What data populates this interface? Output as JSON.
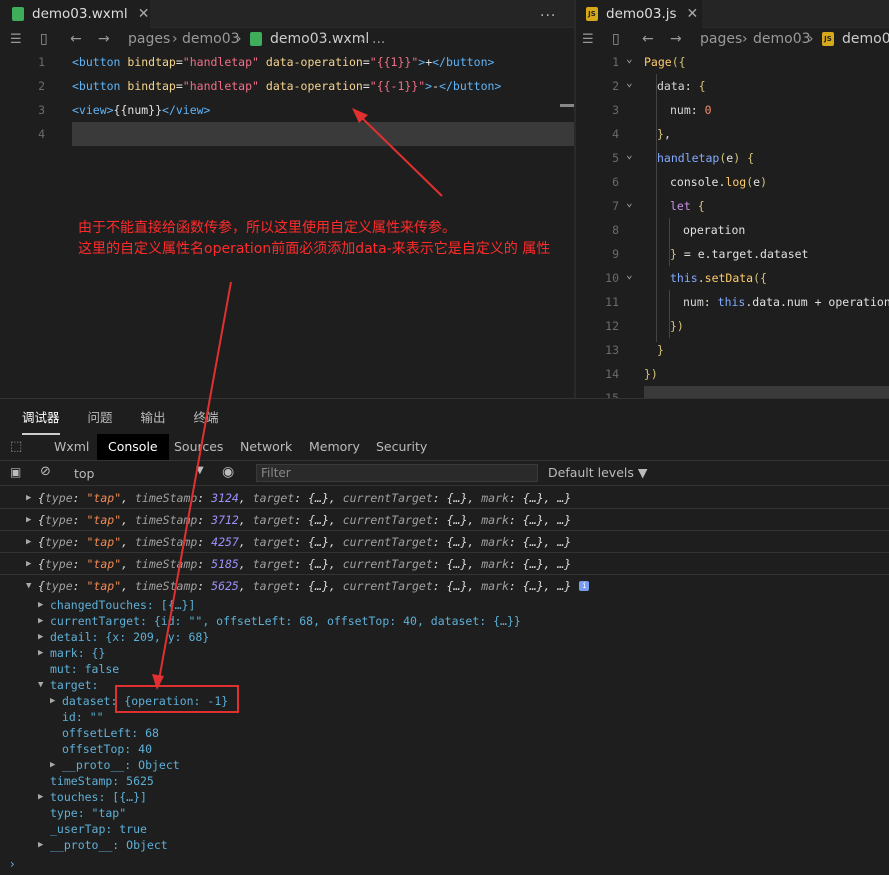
{
  "left_editor": {
    "tab": {
      "name": "demo03.wxml",
      "close": "✕"
    },
    "more": "...",
    "breadcrumb": {
      "part1": "pages",
      "part2": "demo03",
      "part3": "demo03.wxml",
      "ellipsis": "..."
    },
    "lines": [
      {
        "num": "1",
        "segs": [
          [
            "t-tag",
            "<button "
          ],
          [
            "t-attr",
            "bindtap"
          ],
          [
            "t-plain",
            "="
          ],
          [
            "t-str",
            "\"handletap\""
          ],
          [
            "t-plain",
            " "
          ],
          [
            "t-attr",
            "data-operation"
          ],
          [
            "t-plain",
            "="
          ],
          [
            "t-str",
            "\"{{1}}\""
          ],
          [
            "t-tag",
            ">"
          ],
          [
            "t-plain",
            "+"
          ],
          [
            "t-tag",
            "</button>"
          ]
        ]
      },
      {
        "num": "2",
        "segs": [
          [
            "t-tag",
            "<button "
          ],
          [
            "t-attr",
            "bindtap"
          ],
          [
            "t-plain",
            "="
          ],
          [
            "t-str",
            "\"handletap\""
          ],
          [
            "t-plain",
            " "
          ],
          [
            "t-attr",
            "data-operation"
          ],
          [
            "t-plain",
            "="
          ],
          [
            "t-str",
            "\"{{-1}}\""
          ],
          [
            "t-tag",
            ">"
          ],
          [
            "t-plain",
            "-"
          ],
          [
            "t-tag",
            "</button>"
          ]
        ]
      },
      {
        "num": "3",
        "segs": [
          [
            "t-tag",
            "<view>"
          ],
          [
            "t-plain",
            "{{num}}"
          ],
          [
            "t-tag",
            "</view>"
          ]
        ]
      },
      {
        "num": "4",
        "segs": []
      }
    ],
    "annotation": [
      "由于不能直接给函数传参，所以这里使用自定义属性来传参。",
      "这里的自定义属性名operation前面必须添加data-来表示它是自定义的 属性"
    ]
  },
  "right_editor": {
    "tab": {
      "name": "demo03.js",
      "close": "✕"
    },
    "breadcrumb": {
      "part1": "pages",
      "part2": "demo03",
      "part3": "demo0"
    },
    "lines": [
      {
        "num": "1",
        "segs": [
          [
            "t-fn",
            "Page"
          ],
          [
            "t-pun",
            "({"
          ]
        ]
      },
      {
        "num": "2",
        "segs": [
          [
            "t-prop",
            "data"
          ],
          [
            "t-plain",
            ": "
          ],
          [
            "t-pun",
            "{"
          ]
        ]
      },
      {
        "num": "3",
        "segs": [
          [
            "t-prop",
            "num"
          ],
          [
            "t-plain",
            ": "
          ],
          [
            "t-num",
            "0"
          ]
        ]
      },
      {
        "num": "4",
        "segs": [
          [
            "t-pun",
            "}"
          ],
          [
            "t-plain",
            ","
          ]
        ]
      },
      {
        "num": "5",
        "segs": [
          [
            "t-blue",
            "handletap"
          ],
          [
            "t-pun",
            "("
          ],
          [
            "t-plain",
            "e"
          ],
          [
            "t-pun",
            ")"
          ],
          [
            "t-plain",
            " "
          ],
          [
            "t-pun",
            "{"
          ]
        ]
      },
      {
        "num": "6",
        "segs": [
          [
            "t-plain",
            "console"
          ],
          [
            "t-plain",
            "."
          ],
          [
            "t-fn",
            "log"
          ],
          [
            "t-pun",
            "("
          ],
          [
            "t-plain",
            "e"
          ],
          [
            "t-pun",
            ")"
          ]
        ]
      },
      {
        "num": "7",
        "segs": [
          [
            "t-key",
            "let"
          ],
          [
            "t-plain",
            " "
          ],
          [
            "t-pun",
            "{"
          ]
        ]
      },
      {
        "num": "8",
        "segs": [
          [
            "t-plain",
            "operation"
          ]
        ]
      },
      {
        "num": "9",
        "segs": [
          [
            "t-pun",
            "}"
          ],
          [
            "t-plain",
            " = e.target.dataset"
          ]
        ]
      },
      {
        "num": "10",
        "segs": [
          [
            "t-blue",
            "this"
          ],
          [
            "t-plain",
            "."
          ],
          [
            "t-fn",
            "setData"
          ],
          [
            "t-pun",
            "({"
          ]
        ]
      },
      {
        "num": "11",
        "segs": [
          [
            "t-prop",
            "num"
          ],
          [
            "t-plain",
            ": "
          ],
          [
            "t-blue",
            "this"
          ],
          [
            "t-plain",
            ".data.num + operation"
          ]
        ]
      },
      {
        "num": "12",
        "segs": [
          [
            "t-pun",
            "})"
          ]
        ]
      },
      {
        "num": "13",
        "segs": [
          [
            "t-pun",
            "}"
          ]
        ]
      },
      {
        "num": "14",
        "segs": [
          [
            "t-pun",
            "})"
          ]
        ]
      },
      {
        "num": "15",
        "segs": []
      }
    ]
  },
  "devtools": {
    "top_tabs": [
      "调试器",
      "问题",
      "输出",
      "终端"
    ],
    "sub_tabs": [
      "Wxml",
      "Console",
      "Sources",
      "Network",
      "Memory",
      "Security"
    ],
    "context": "top",
    "filter_placeholder": "Filter",
    "levels": "Default levels ▼",
    "collapsed_rows": [
      {
        "ts": "3124"
      },
      {
        "ts": "3712"
      },
      {
        "ts": "4257"
      },
      {
        "ts": "5185"
      }
    ],
    "expanded_ts": "5625",
    "tree": {
      "changedTouches": "changedTouches: [{…}]",
      "currentTarget": "currentTarget: {id: \"\", offsetLeft: 68, offsetTop: 40, dataset: {…}}",
      "detail": "detail: {x: 209, y: 68}",
      "mark": "mark: {}",
      "mut": "mut: false",
      "target": "target:",
      "dataset": "dataset: {operation: -1}",
      "id": "id: \"\"",
      "offsetLeft": "offsetLeft: 68",
      "offsetTop": "offsetTop: 40",
      "proto1": "__proto__: Object",
      "timeStamp": "timeStamp: 5625",
      "touches": "touches: [{…}]",
      "type": "type: \"tap\"",
      "userTap": "_userTap: true",
      "proto2": "__proto__: Object"
    },
    "prompt": "›"
  },
  "colors": {
    "annotation": "#ff2b2b",
    "box": "#e03030"
  }
}
